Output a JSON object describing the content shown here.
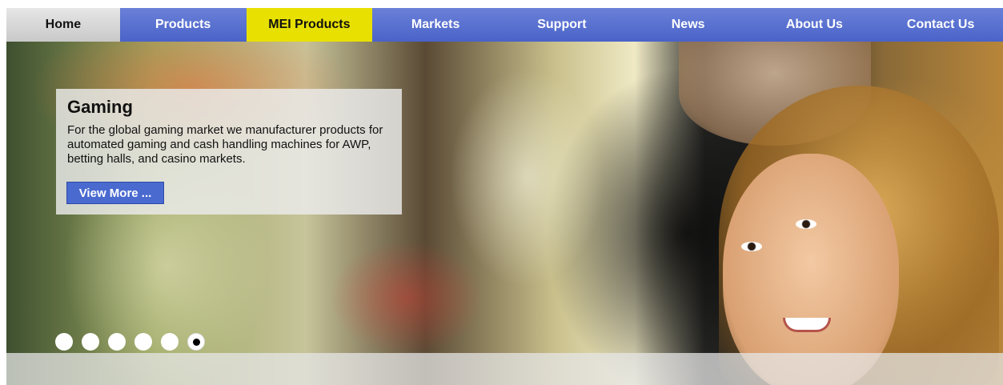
{
  "nav": {
    "items": [
      {
        "label": "Home"
      },
      {
        "label": "Products"
      },
      {
        "label": "MEI Products"
      },
      {
        "label": "Markets"
      },
      {
        "label": "Support"
      },
      {
        "label": "News"
      },
      {
        "label": "About Us"
      },
      {
        "label": "Contact Us"
      }
    ],
    "active_color": "#e8e000",
    "bar_color": "#5a72d0"
  },
  "hero": {
    "title": "Gaming",
    "text": "For the global gaming market we manufacturer products for automated gaming and cash handling machines for AWP, betting halls, and casino markets.",
    "button_label": "View More ..."
  },
  "carousel": {
    "slide_count": 6,
    "active_slide": 6
  }
}
